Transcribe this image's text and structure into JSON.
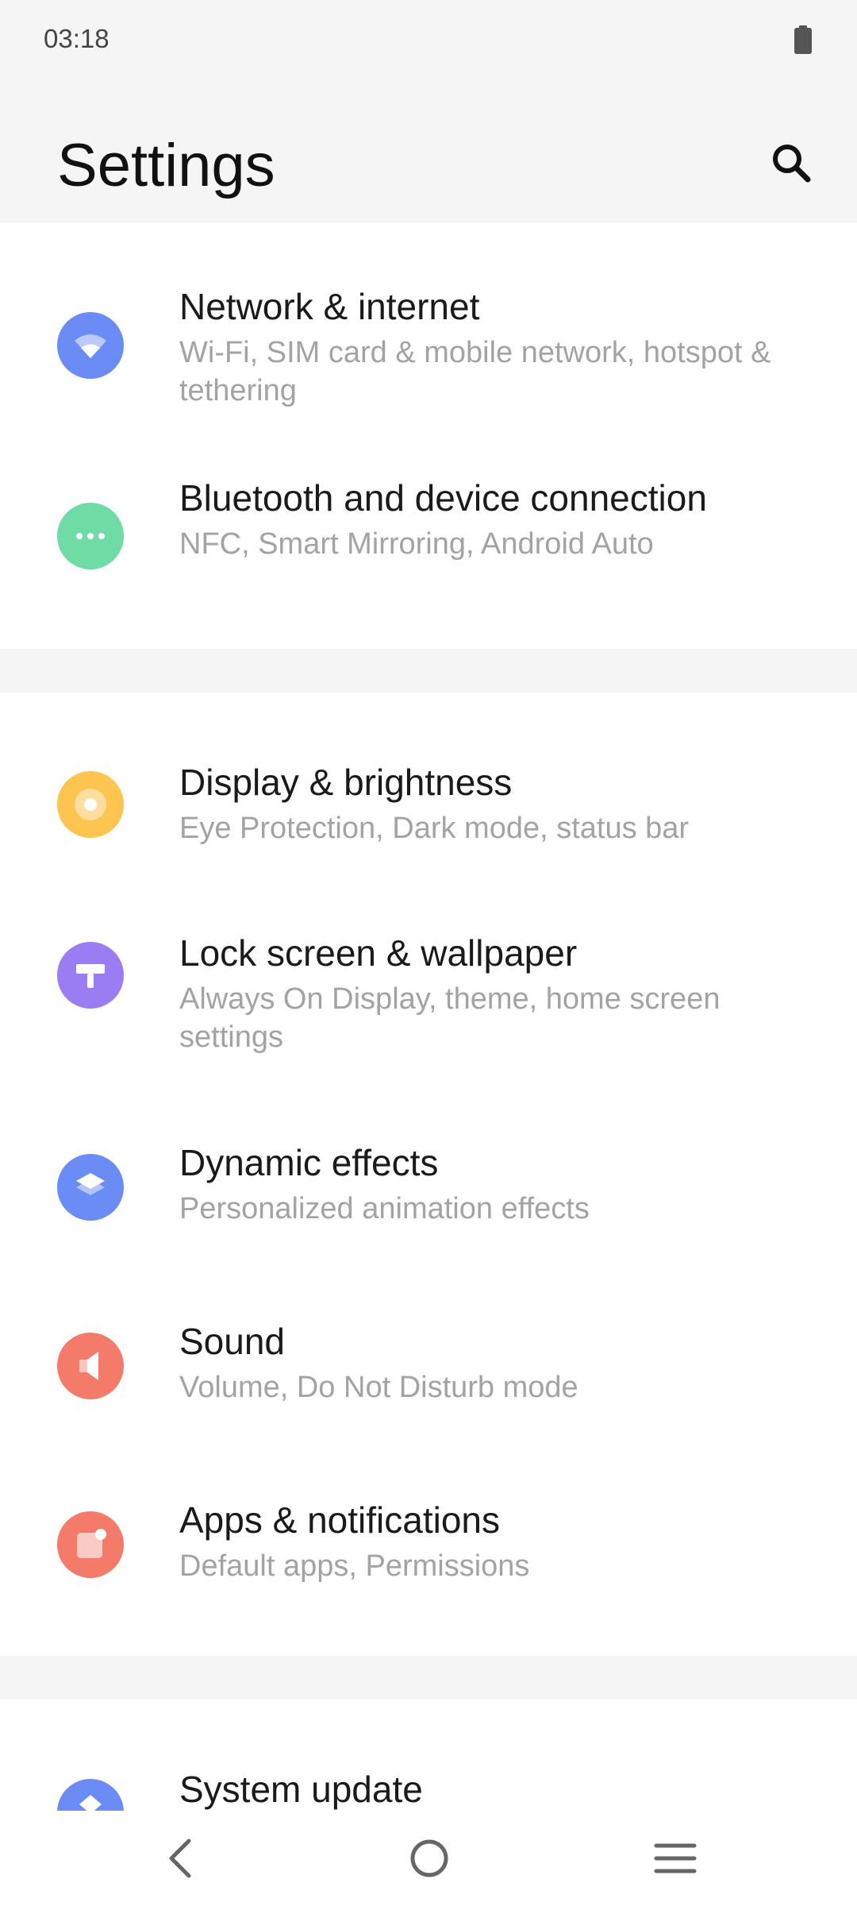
{
  "status_bar": {
    "time": "03:18"
  },
  "header": {
    "title": "Settings",
    "search_icon": "search-icon"
  },
  "groups": [
    {
      "items": [
        {
          "title": "Network & internet",
          "subtitle": "Wi-Fi, SIM card & mobile network, hotspot & tethering",
          "icon": "wifi-icon",
          "color": "#6B8BF5"
        },
        {
          "title": "Bluetooth and device connection",
          "subtitle": "NFC, Smart Mirroring, Android Auto",
          "icon": "more-dots-icon",
          "color": "#6FDCA6"
        }
      ]
    },
    {
      "items": [
        {
          "title": "Display & brightness",
          "subtitle": "Eye Protection, Dark mode, status bar",
          "icon": "brightness-icon",
          "color": "#FDC44F"
        },
        {
          "title": "Lock screen & wallpaper",
          "subtitle": "Always On Display, theme, home screen settings",
          "icon": "paint-roller-icon",
          "color": "#9A7DF2"
        },
        {
          "title": "Dynamic effects",
          "subtitle": "Personalized animation effects",
          "icon": "layers-icon",
          "color": "#6B8BF5"
        },
        {
          "title": "Sound",
          "subtitle": "Volume, Do Not Disturb mode",
          "icon": "speaker-icon",
          "color": "#F47B6A"
        },
        {
          "title": "Apps & notifications",
          "subtitle": "Default apps, Permissions",
          "icon": "app-notification-icon",
          "color": "#F47B6A"
        }
      ]
    },
    {
      "items": [
        {
          "title": "System update",
          "icon": "system-update-icon",
          "color": "#6B8BF5"
        }
      ]
    }
  ],
  "nav_bar": {
    "back_icon": "back-icon",
    "home_icon": "home-icon",
    "menu_icon": "menu-icon"
  }
}
